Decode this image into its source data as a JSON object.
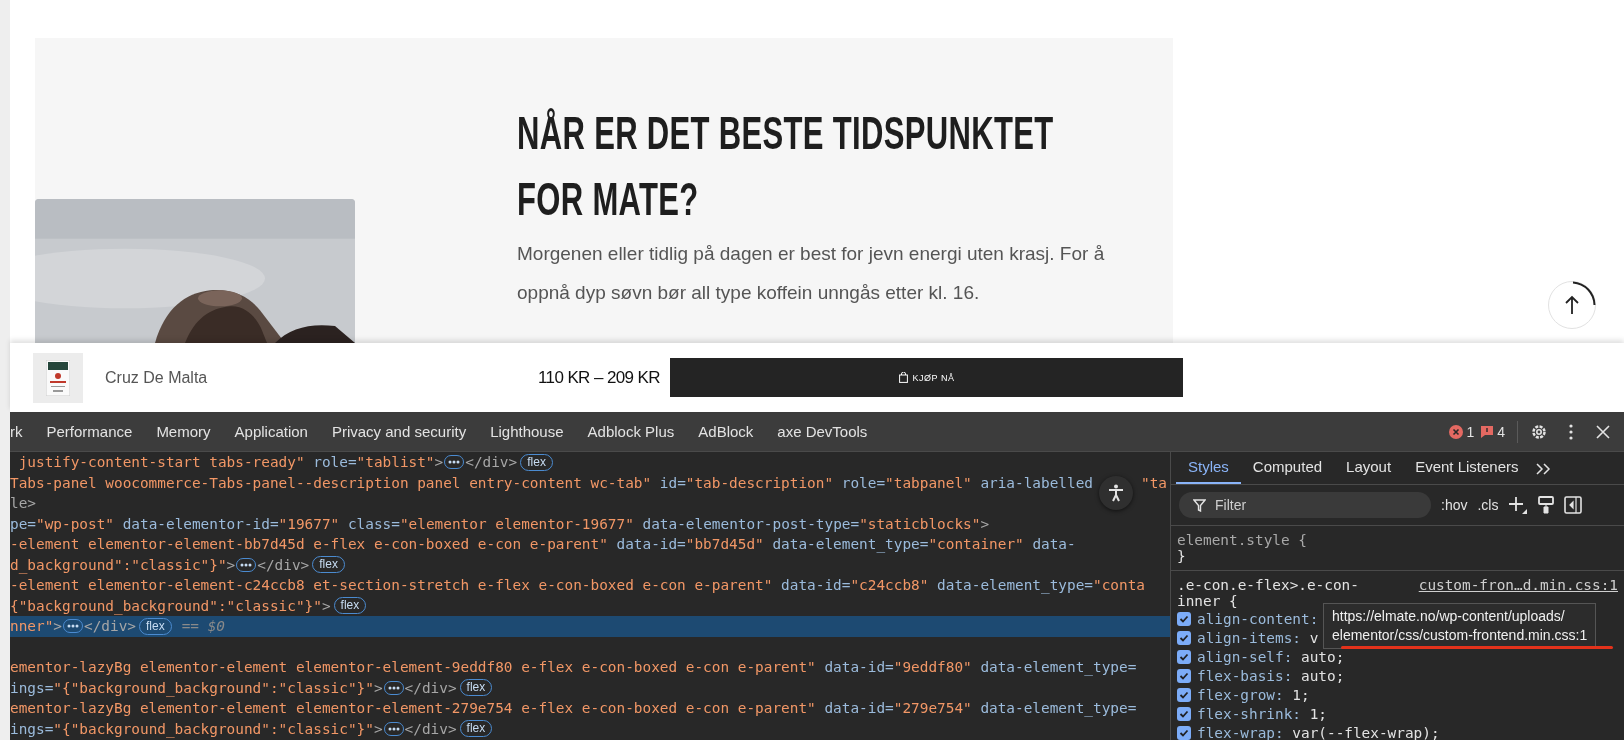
{
  "page": {
    "heading": "NÅR ER DET BESTE TIDSPUNKTET FOR MATE?",
    "paragraph": "Morgenen eller tidlig på dagen er best for jevn energi uten krasj. For å oppnå dyp søvn bør all type koffein unngås etter kl. 16."
  },
  "sticky_bar": {
    "product": "Cruz De Malta",
    "price": "110 KR – 209 KR",
    "button": "KJØP NÅ"
  },
  "devtools": {
    "tabs": [
      "rk",
      "Performance",
      "Memory",
      "Application",
      "Privacy and security",
      "Lighthouse",
      "Adblock Plus",
      "AdBlock",
      "axe DevTools"
    ],
    "errors": "1",
    "issues": "4",
    "elements": [
      {
        "selected": false,
        "segments": [
          {
            "kind": "value",
            "text": " justify-content-start tabs-ready\""
          },
          {
            "kind": "attr",
            "text": " role="
          },
          {
            "kind": "value",
            "text": "\"tablist\""
          },
          {
            "kind": "tag",
            "text": ">"
          },
          {
            "kind": "ellipsis"
          },
          {
            "kind": "tag",
            "text": "</div>"
          },
          {
            "kind": "badge",
            "text": "flex"
          }
        ]
      },
      {
        "selected": false,
        "segments": [
          {
            "kind": "value",
            "text": "Tabs-panel woocommerce-Tabs-panel--description panel entry-content wc-tab\""
          },
          {
            "kind": "attr",
            "text": " id="
          },
          {
            "kind": "value",
            "text": "\"tab-description\""
          },
          {
            "kind": "attr",
            "text": " role="
          },
          {
            "kind": "value",
            "text": "\"tabpanel\""
          },
          {
            "kind": "attr",
            "text": " aria-labelled"
          },
          {
            "kind": "a11y"
          },
          {
            "kind": "value",
            "text": "\"ta"
          }
        ]
      },
      {
        "selected": false,
        "segments": [
          {
            "kind": "tag",
            "text": "le>"
          }
        ]
      },
      {
        "selected": false,
        "segments": [
          {
            "kind": "attr",
            "text": "pe="
          },
          {
            "kind": "value",
            "text": "\"wp-post\""
          },
          {
            "kind": "attr",
            "text": " data-elementor-id="
          },
          {
            "kind": "value",
            "text": "\"19677\""
          },
          {
            "kind": "attr",
            "text": " class="
          },
          {
            "kind": "value",
            "text": "\"elementor elementor-19677\""
          },
          {
            "kind": "attr",
            "text": " data-elementor-post-type="
          },
          {
            "kind": "value",
            "text": "\"staticblocks\""
          },
          {
            "kind": "tag",
            "text": ">"
          }
        ]
      },
      {
        "selected": false,
        "segments": [
          {
            "kind": "value",
            "text": "-element elementor-element-bb7d45d e-flex e-con-boxed e-con e-parent\""
          },
          {
            "kind": "attr",
            "text": " data-id="
          },
          {
            "kind": "value",
            "text": "\"bb7d45d\""
          },
          {
            "kind": "attr",
            "text": " data-element_type="
          },
          {
            "kind": "value",
            "text": "\"container\""
          },
          {
            "kind": "attr",
            "text": " data-"
          }
        ]
      },
      {
        "selected": false,
        "segments": [
          {
            "kind": "value",
            "text": "d_background\":\"classic\"}\""
          },
          {
            "kind": "tag",
            "text": ">"
          },
          {
            "kind": "ellipsis"
          },
          {
            "kind": "tag",
            "text": "</div>"
          },
          {
            "kind": "badge",
            "text": "flex"
          }
        ]
      },
      {
        "selected": false,
        "segments": [
          {
            "kind": "value",
            "text": "-element elementor-element-c24ccb8 et-section-stretch e-flex e-con-boxed e-con e-parent\""
          },
          {
            "kind": "attr",
            "text": " data-id="
          },
          {
            "kind": "value",
            "text": "\"c24ccb8\""
          },
          {
            "kind": "attr",
            "text": " data-element_type="
          },
          {
            "kind": "value",
            "text": "\"conta"
          }
        ]
      },
      {
        "selected": false,
        "segments": [
          {
            "kind": "value",
            "text": "{\"background_background\":\"classic\"}\""
          },
          {
            "kind": "tag",
            "text": ">"
          },
          {
            "kind": "badge",
            "text": "flex"
          }
        ]
      },
      {
        "selected": true,
        "segments": [
          {
            "kind": "value",
            "text": "nner\""
          },
          {
            "kind": "tag",
            "text": ">"
          },
          {
            "kind": "ellipsis"
          },
          {
            "kind": "tag",
            "text": "</div>"
          },
          {
            "kind": "badge",
            "text": "flex"
          },
          {
            "kind": "plain",
            "text": "== $0"
          }
        ]
      },
      {
        "selected": false
      },
      {
        "selected": false,
        "segments": [
          {
            "kind": "value",
            "text": "ementor-lazyBg elementor-element elementor-element-9eddf80 e-flex e-con-boxed e-con e-parent\""
          },
          {
            "kind": "attr",
            "text": " data-id="
          },
          {
            "kind": "value",
            "text": "\"9eddf80\""
          },
          {
            "kind": "attr",
            "text": " data-element_type="
          }
        ]
      },
      {
        "selected": false,
        "segments": [
          {
            "kind": "attr",
            "text": "ings="
          },
          {
            "kind": "value",
            "text": "\"{\"background_background\":\"classic\"}\""
          },
          {
            "kind": "tag",
            "text": ">"
          },
          {
            "kind": "ellipsis"
          },
          {
            "kind": "tag",
            "text": "</div>"
          },
          {
            "kind": "badge",
            "text": "flex"
          }
        ]
      },
      {
        "selected": false,
        "segments": [
          {
            "kind": "value",
            "text": "ementor-lazyBg elementor-element elementor-element-279e754 e-flex e-con-boxed e-con e-parent\""
          },
          {
            "kind": "attr",
            "text": " data-id="
          },
          {
            "kind": "value",
            "text": "\"279e754\""
          },
          {
            "kind": "attr",
            "text": " data-element_type="
          }
        ]
      },
      {
        "selected": false,
        "segments": [
          {
            "kind": "attr",
            "text": "ings="
          },
          {
            "kind": "value",
            "text": "\"{\"background_background\":\"classic\"}\""
          },
          {
            "kind": "tag",
            "text": ">"
          },
          {
            "kind": "ellipsis"
          },
          {
            "kind": "tag",
            "text": "</div>"
          },
          {
            "kind": "badge",
            "text": "flex"
          }
        ]
      }
    ],
    "styles": {
      "tabs": [
        {
          "label": "Styles",
          "selected": true
        },
        {
          "label": "Computed",
          "selected": false
        },
        {
          "label": "Layout",
          "selected": false
        },
        {
          "label": "Event Listeners",
          "selected": false
        }
      ],
      "filter": {
        "placeholder": "Filter"
      },
      "hov": ":hov",
      "cls": ".cls",
      "element_style": {
        "open": "element.style {",
        "close": "}"
      },
      "rule": {
        "selector_line_1": ".e-con.e-flex>.e-con-",
        "selector_line_2": "inner {",
        "source": "custom-fron…d.min.css:1",
        "properties": [
          {
            "name": "align-content:",
            "checked": true
          },
          {
            "name": "align-items:",
            "value": "v",
            "checked": true
          },
          {
            "name": "align-self:",
            "value": "auto;",
            "checked": true
          },
          {
            "name": "flex-basis:",
            "value": "auto;",
            "checked": true
          },
          {
            "name": "flex-grow:",
            "value": "1;",
            "checked": true
          },
          {
            "name": "flex-shrink:",
            "value": "1;",
            "checked": true
          },
          {
            "name": "flex-wrap:",
            "value": "var(--flex-wrap);",
            "checked": true
          }
        ]
      },
      "tooltip": {
        "line_1": "https://elmate.no/wp-content/uploads/",
        "line_2": "elementor/css/custom-frontend.min.css:1"
      }
    }
  }
}
